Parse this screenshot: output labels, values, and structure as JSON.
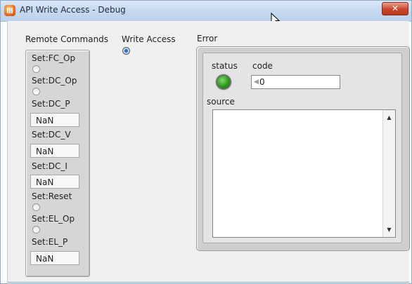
{
  "window": {
    "title": "API Write Access - Debug",
    "close_label": "✕"
  },
  "remote_commands": {
    "label": "Remote Commands",
    "items": [
      {
        "label": "Set:FC_Op"
      },
      {
        "label": "Set:DC_Op"
      },
      {
        "label": "Set:DC_P",
        "value": "NaN"
      },
      {
        "label": "Set:DC_V",
        "value": "NaN"
      },
      {
        "label": "Set:DC_I",
        "value": "NaN"
      },
      {
        "label": "Set:Reset"
      },
      {
        "label": "Set:EL_Op"
      },
      {
        "label": "Set:EL_P",
        "value": "NaN"
      }
    ]
  },
  "write_access": {
    "label": "Write Access",
    "checked": true
  },
  "error": {
    "label": "Error",
    "status_label": "status",
    "status_color": "#2e9a1e",
    "code_label": "code",
    "code_value": "0",
    "source_label": "source",
    "source_value": ""
  },
  "colors": {
    "titlebar": "#c7d9f0",
    "panel": "#d6d6d6",
    "client": "#f0f0f0"
  }
}
